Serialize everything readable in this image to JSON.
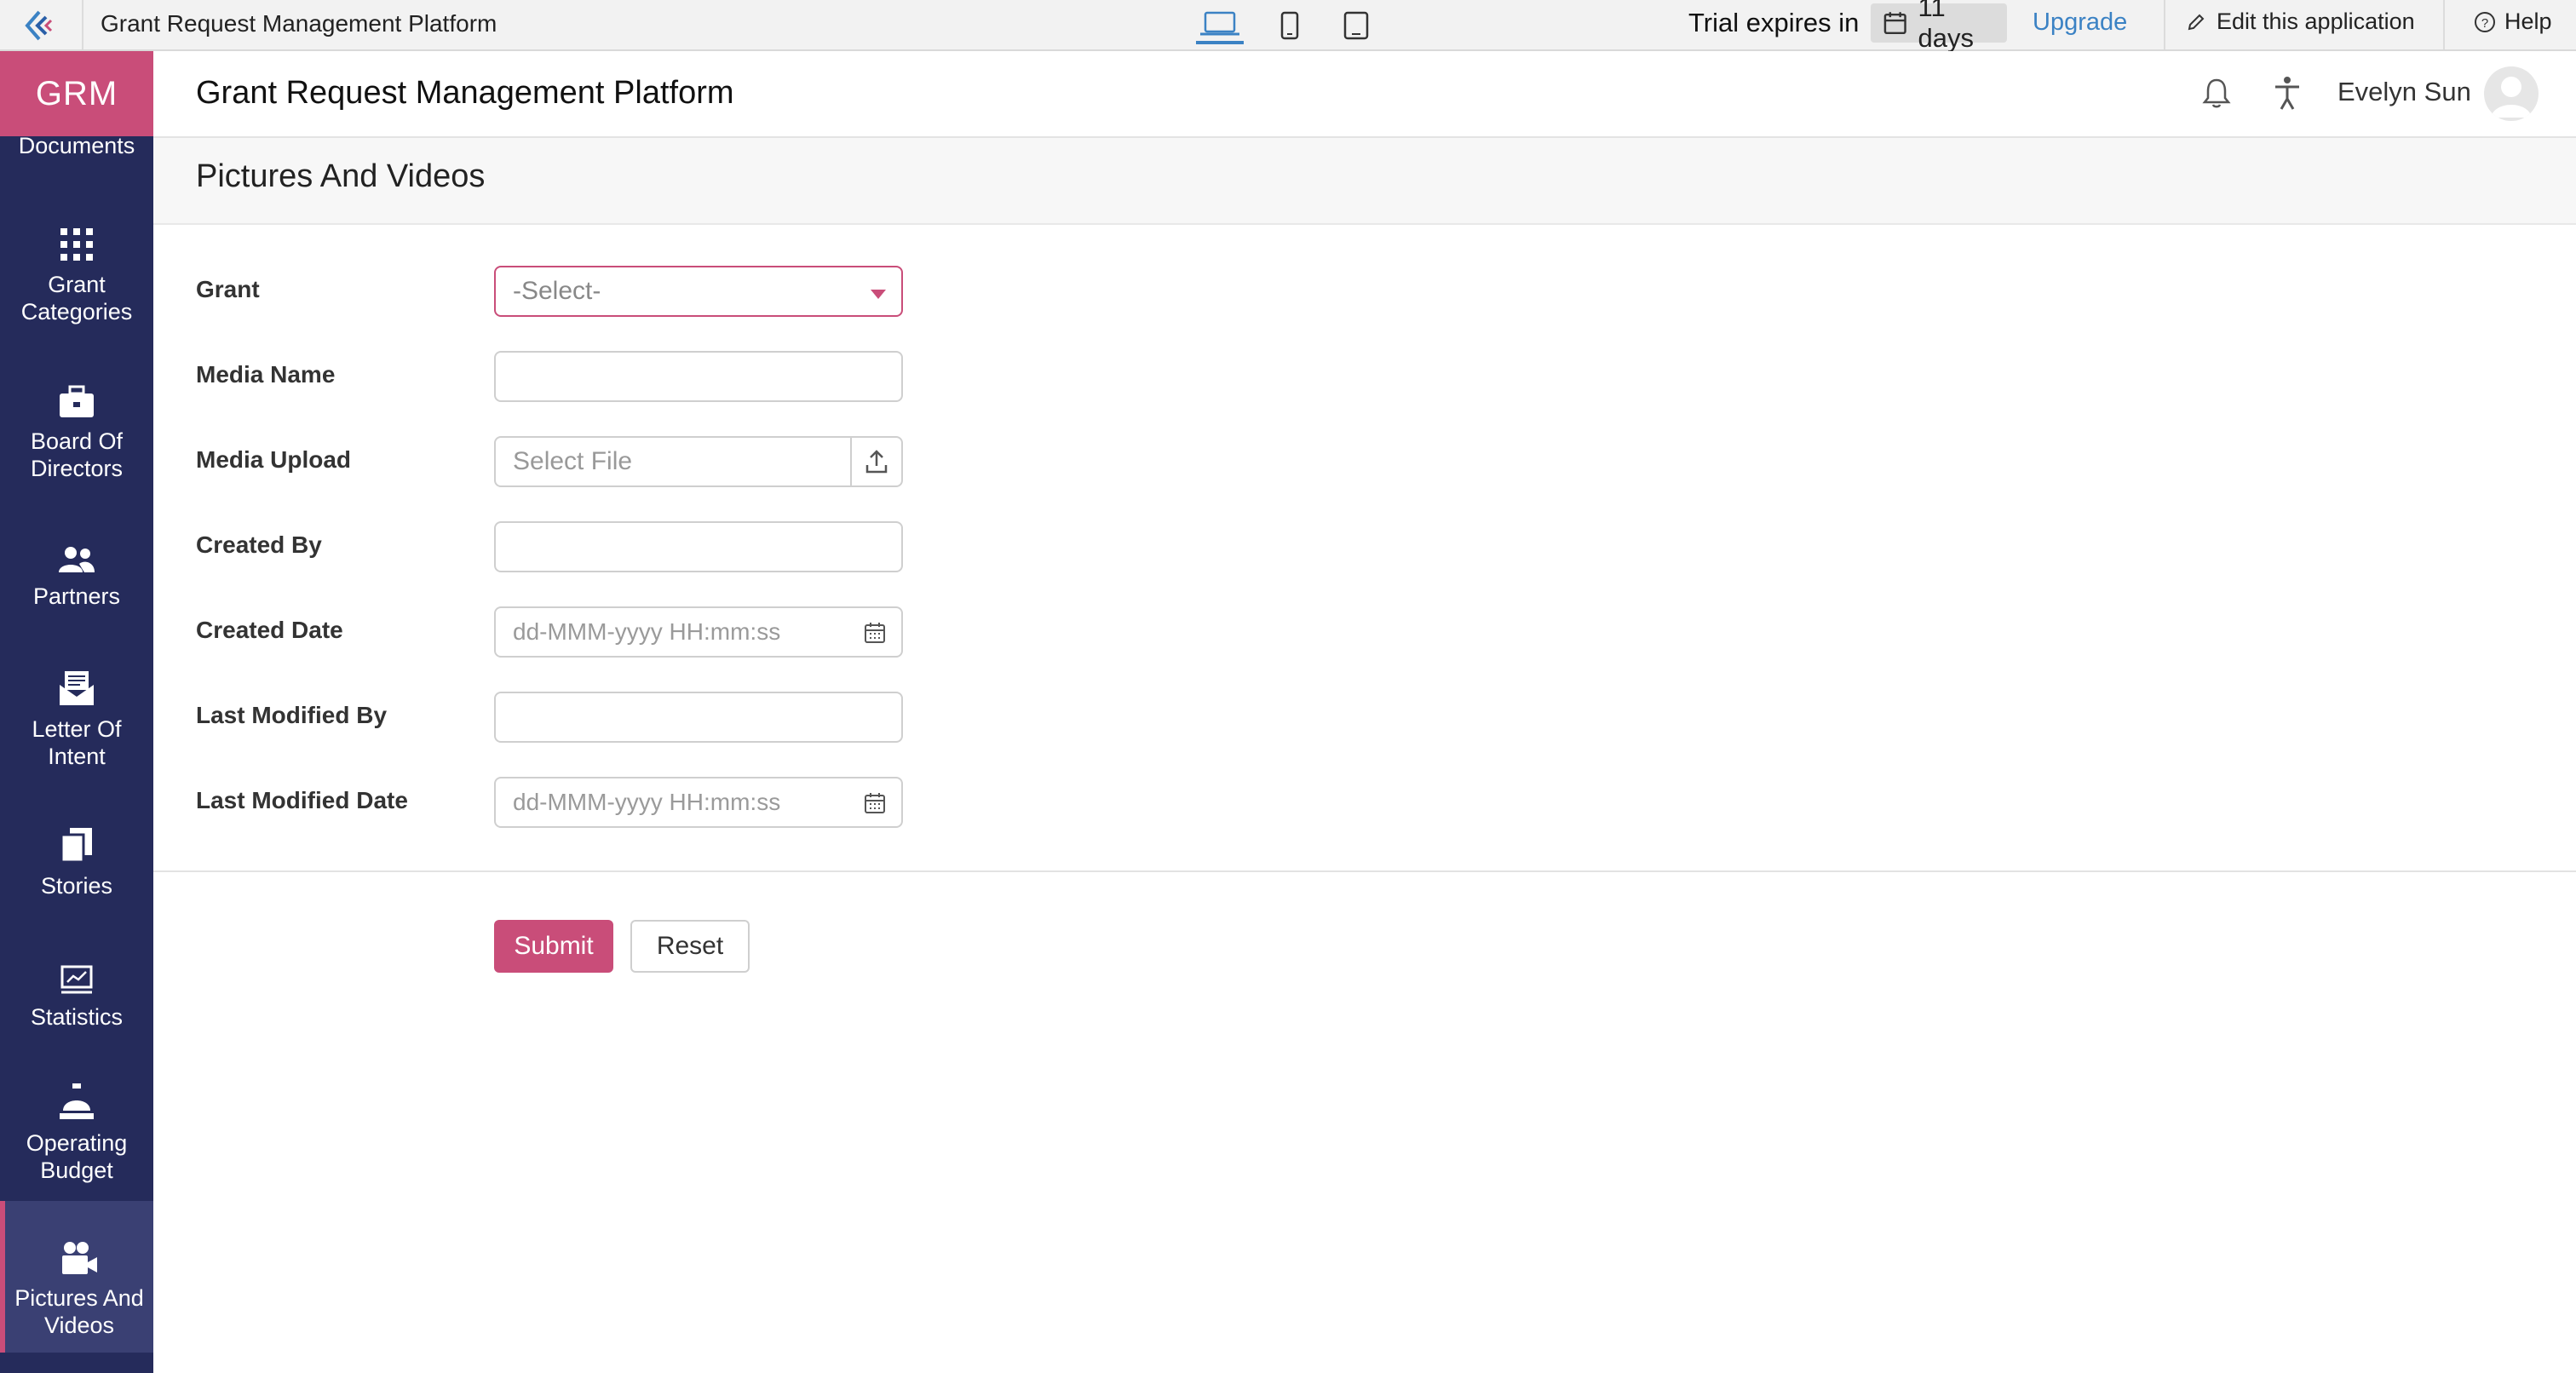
{
  "topbar": {
    "app_title": "Grant Request Management Platform",
    "trial_text": "Trial expires in",
    "trial_days": "11 days",
    "upgrade_label": "Upgrade",
    "edit_label": "Edit this application",
    "help_label": "Help",
    "devices": [
      "laptop-icon",
      "mobile-icon",
      "tablet-icon"
    ],
    "active_device": "laptop"
  },
  "sidebar": {
    "brand": "GRM",
    "partial_item": "Documents",
    "items": [
      {
        "label": "Grant Categories",
        "icon": "grid-icon"
      },
      {
        "label": "Board Of Directors",
        "icon": "briefcase-icon"
      },
      {
        "label": "Partners",
        "icon": "people-icon"
      },
      {
        "label": "Letter Of Intent",
        "icon": "envelope-icon"
      },
      {
        "label": "Stories",
        "icon": "copy-icon"
      },
      {
        "label": "Statistics",
        "icon": "chart-icon"
      },
      {
        "label": "Operating Budget",
        "icon": "bell-desk-icon"
      },
      {
        "label": "Pictures And Videos",
        "icon": "video-camera-icon"
      }
    ],
    "active_item": "Pictures And Videos"
  },
  "header": {
    "title": "Grant Request Management Platform",
    "user_name": "Evelyn Sun"
  },
  "page": {
    "title": "Pictures And Videos"
  },
  "form": {
    "fields": [
      {
        "label": "Grant",
        "type": "select",
        "value": "-Select-"
      },
      {
        "label": "Media Name",
        "type": "text",
        "value": ""
      },
      {
        "label": "Media Upload",
        "type": "file",
        "placeholder": "Select File"
      },
      {
        "label": "Created By",
        "type": "text",
        "value": ""
      },
      {
        "label": "Created Date",
        "type": "datetime",
        "placeholder": "dd-MMM-yyyy HH:mm:ss"
      },
      {
        "label": "Last Modified By",
        "type": "text",
        "value": ""
      },
      {
        "label": "Last Modified Date",
        "type": "datetime",
        "placeholder": "dd-MMM-yyyy HH:mm:ss"
      }
    ],
    "submit_label": "Submit",
    "reset_label": "Reset"
  },
  "colors": {
    "brand_pink": "#c94d79",
    "sidebar_bg": "#252b5b",
    "link_blue": "#3b82c4"
  }
}
